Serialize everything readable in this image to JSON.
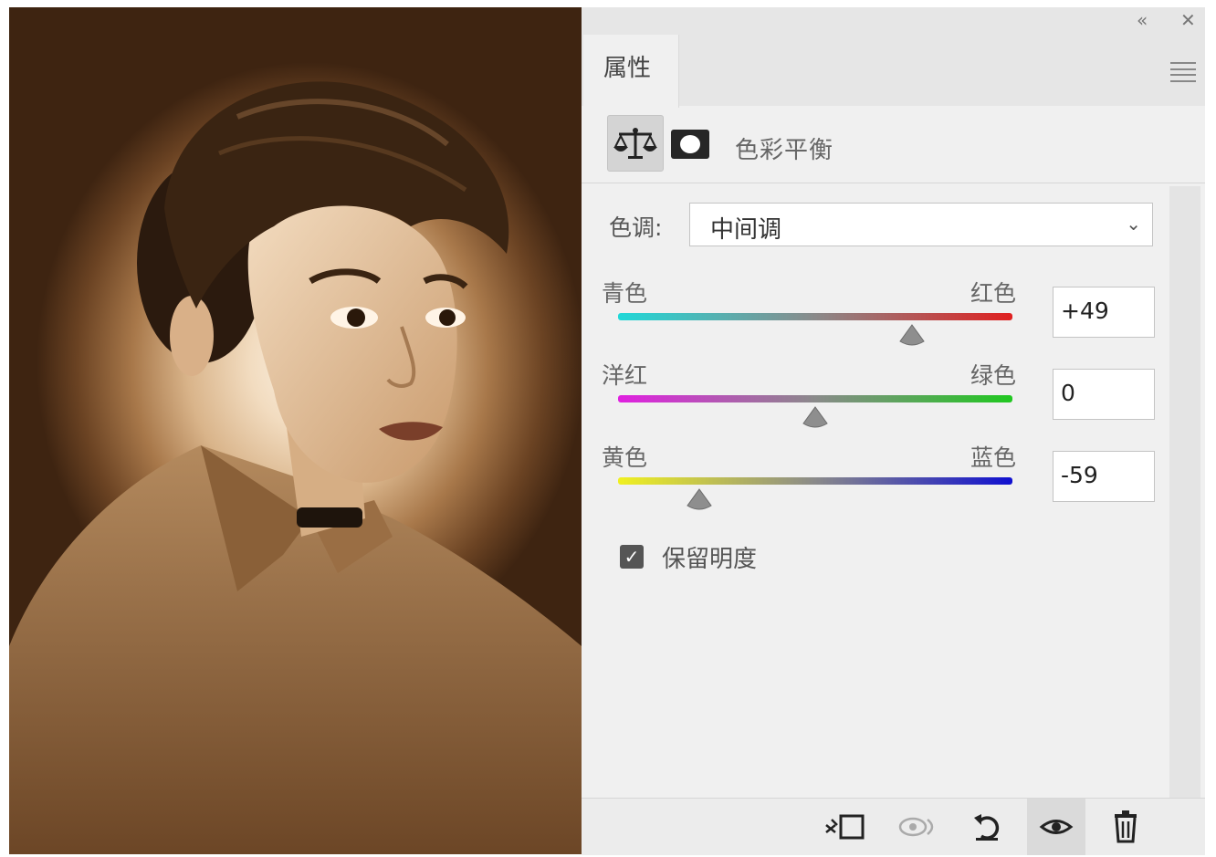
{
  "window": {
    "collapse_glyph": "«",
    "close_glyph": "✕"
  },
  "panel": {
    "tab_label": "属性",
    "adjustment_title": "色彩平衡",
    "tone": {
      "label": "色调:",
      "selected": "中间调"
    },
    "sliders": [
      {
        "left_label": "青色",
        "right_label": "红色",
        "value": "+49",
        "numeric": 49,
        "gradient": [
          "#20d8d8",
          "#e02020"
        ]
      },
      {
        "left_label": "洋红",
        "right_label": "绿色",
        "value": "0",
        "numeric": 0,
        "gradient": [
          "#e020e0",
          "#20c820"
        ]
      },
      {
        "left_label": "黄色",
        "right_label": "蓝色",
        "value": "-59",
        "numeric": -59,
        "gradient": [
          "#f0f020",
          "#1010d0"
        ]
      }
    ],
    "preserve_luminosity": {
      "label": "保留明度",
      "checked": true
    },
    "bottom_icons": [
      "clip-to-layer-icon",
      "view-previous-state-icon",
      "reset-icon",
      "visibility-eye-icon",
      "delete-trash-icon"
    ]
  },
  "colors": {
    "panel_bg": "#f0f0f0",
    "sepia_dark": "#3e2411",
    "sepia_light": "#fbf1e3"
  }
}
